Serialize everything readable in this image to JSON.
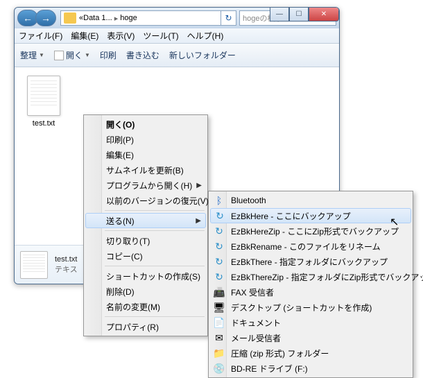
{
  "titlebar": {
    "breadcrumb_prefix": "«",
    "breadcrumb_item1": "Data 1...",
    "breadcrumb_item2": "hoge",
    "search_placeholder": "hogeの検索"
  },
  "menubar": {
    "file": "ファイル(F)",
    "edit": "編集(E)",
    "view": "表示(V)",
    "tools": "ツール(T)",
    "help": "ヘルプ(H)"
  },
  "toolbar": {
    "organize": "整理",
    "open": "開く",
    "print": "印刷",
    "burn": "書き込む",
    "newfolder": "新しいフォルダー"
  },
  "file": {
    "name": "test.txt",
    "type": "テキス"
  },
  "context_menu": {
    "open": "開く(O)",
    "print": "印刷(P)",
    "edit": "編集(E)",
    "refresh_thumb": "サムネイルを更新(B)",
    "open_with": "プログラムから開く(H)",
    "prev_versions": "以前のバージョンの復元(V)",
    "send_to": "送る(N)",
    "cut": "切り取り(T)",
    "copy": "コピー(C)",
    "shortcut": "ショートカットの作成(S)",
    "delete": "削除(D)",
    "rename": "名前の変更(M)",
    "properties": "プロパティ(R)"
  },
  "send_to_menu": {
    "bluetooth": "Bluetooth",
    "ezbkhere": "EzBkHere - ここにバックアップ",
    "ezbkherezip": "EzBkHereZip - ここにZip形式でバックアップ",
    "ezbkrename": "EzBkRename - このファイルをリネーム",
    "ezbkthere": "EzBkThere - 指定フォルダにバックアップ",
    "ezbktherezip": "EzBkThereZip - 指定フォルダにZip形式でバックアップ",
    "fax": "FAX 受信者",
    "desktop": "デスクトップ (ショートカットを作成)",
    "documents": "ドキュメント",
    "mail": "メール受信者",
    "zip": "圧縮 (zip 形式) フォルダー",
    "bdre": "BD-RE ドライブ (F:)"
  }
}
